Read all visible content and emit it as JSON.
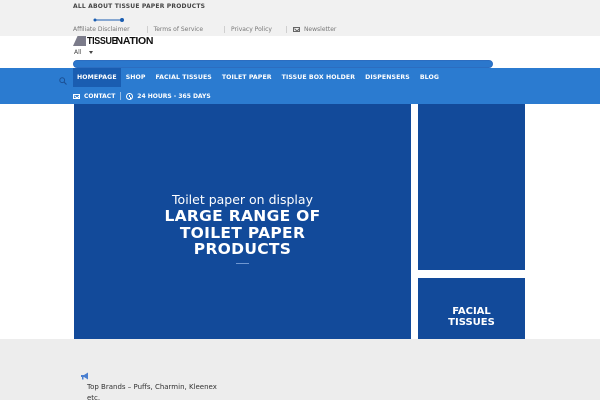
{
  "header": {
    "tagline": "ALL ABOUT TISSUE PAPER PRODUCTS",
    "links": [
      {
        "label": "Affiliate Disclaimer"
      },
      {
        "label": "Terms of Service"
      },
      {
        "label": "Privacy Policy"
      },
      {
        "label": "Newsletter",
        "icon": "mail-icon"
      }
    ]
  },
  "logo": {
    "part1": "TISSUE",
    "part2": "NATION"
  },
  "search": {
    "category_selected": "All"
  },
  "nav": {
    "items": [
      {
        "label": "HOMEPAGE",
        "active": true
      },
      {
        "label": "SHOP"
      },
      {
        "label": "FACIAL TISSUES"
      },
      {
        "label": "TOILET PAPER"
      },
      {
        "label": "TISSUE BOX HOLDER"
      },
      {
        "label": "DISPENSERS"
      },
      {
        "label": "BLOG"
      }
    ],
    "contact_label": "CONTACT",
    "hours_label": "24 HOURS - 365 DAYS"
  },
  "hero": {
    "subtitle": "Toilet paper on display",
    "title_lines": [
      "LARGE RANGE OF",
      "TOILET PAPER",
      "PRODUCTS"
    ]
  },
  "side_banner": {
    "label_lines": [
      "FACIAL",
      "TISSUES"
    ]
  },
  "footer": {
    "brands_text": "Top Brands – Puffs, Charmin, Kleenex etc."
  },
  "colors": {
    "nav_blue": "#2b7bd0",
    "nav_active": "#1a5db1",
    "banner_blue": "#124a9a",
    "topbar_bg": "#f1f1f1"
  }
}
